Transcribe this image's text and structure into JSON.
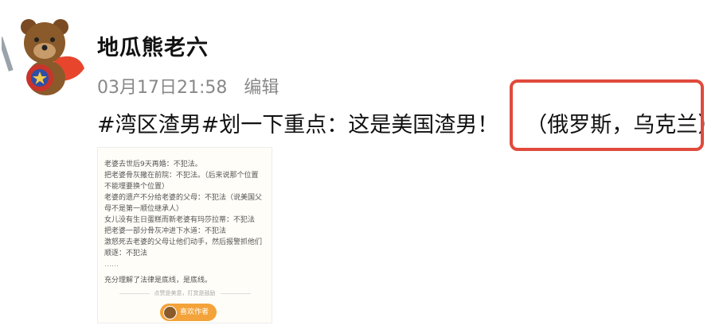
{
  "user": {
    "name": "地瓜熊老六"
  },
  "post": {
    "timestamp": "03月17日21:58",
    "edit_label": "编辑",
    "text": "#湾区渣男#划一下重点：这是美国渣男！",
    "annotation": "（俄罗斯，乌克兰）"
  },
  "image_card": {
    "lines": [
      "老婆去世后9天再婚：不犯法。",
      "把老婆骨灰撒在前院：不犯法。（后来说那个位置",
      "不能埋要换个位置）",
      "老婆的遗产不分给老婆的父母：不犯法（说美国父",
      "母不是第一顺位继承人）",
      "女儿没有生日蛋糕而新老婆有玛莎拉蒂：不犯法",
      "把老婆一部分骨灰冲进下水道：不犯法",
      "激怒死去老婆的父母让他们动手，然后报警抓他们",
      "顺逐：不犯法"
    ],
    "ellipsis": "……",
    "conclusion": "充分理解了法律是底线，是底线。",
    "footer_note": "点赞是美意，打赏是鼓励",
    "like_button": "喜欢作者"
  },
  "colors": {
    "highlight_box": "#e04a3c",
    "like_button": "#f3a33a"
  }
}
